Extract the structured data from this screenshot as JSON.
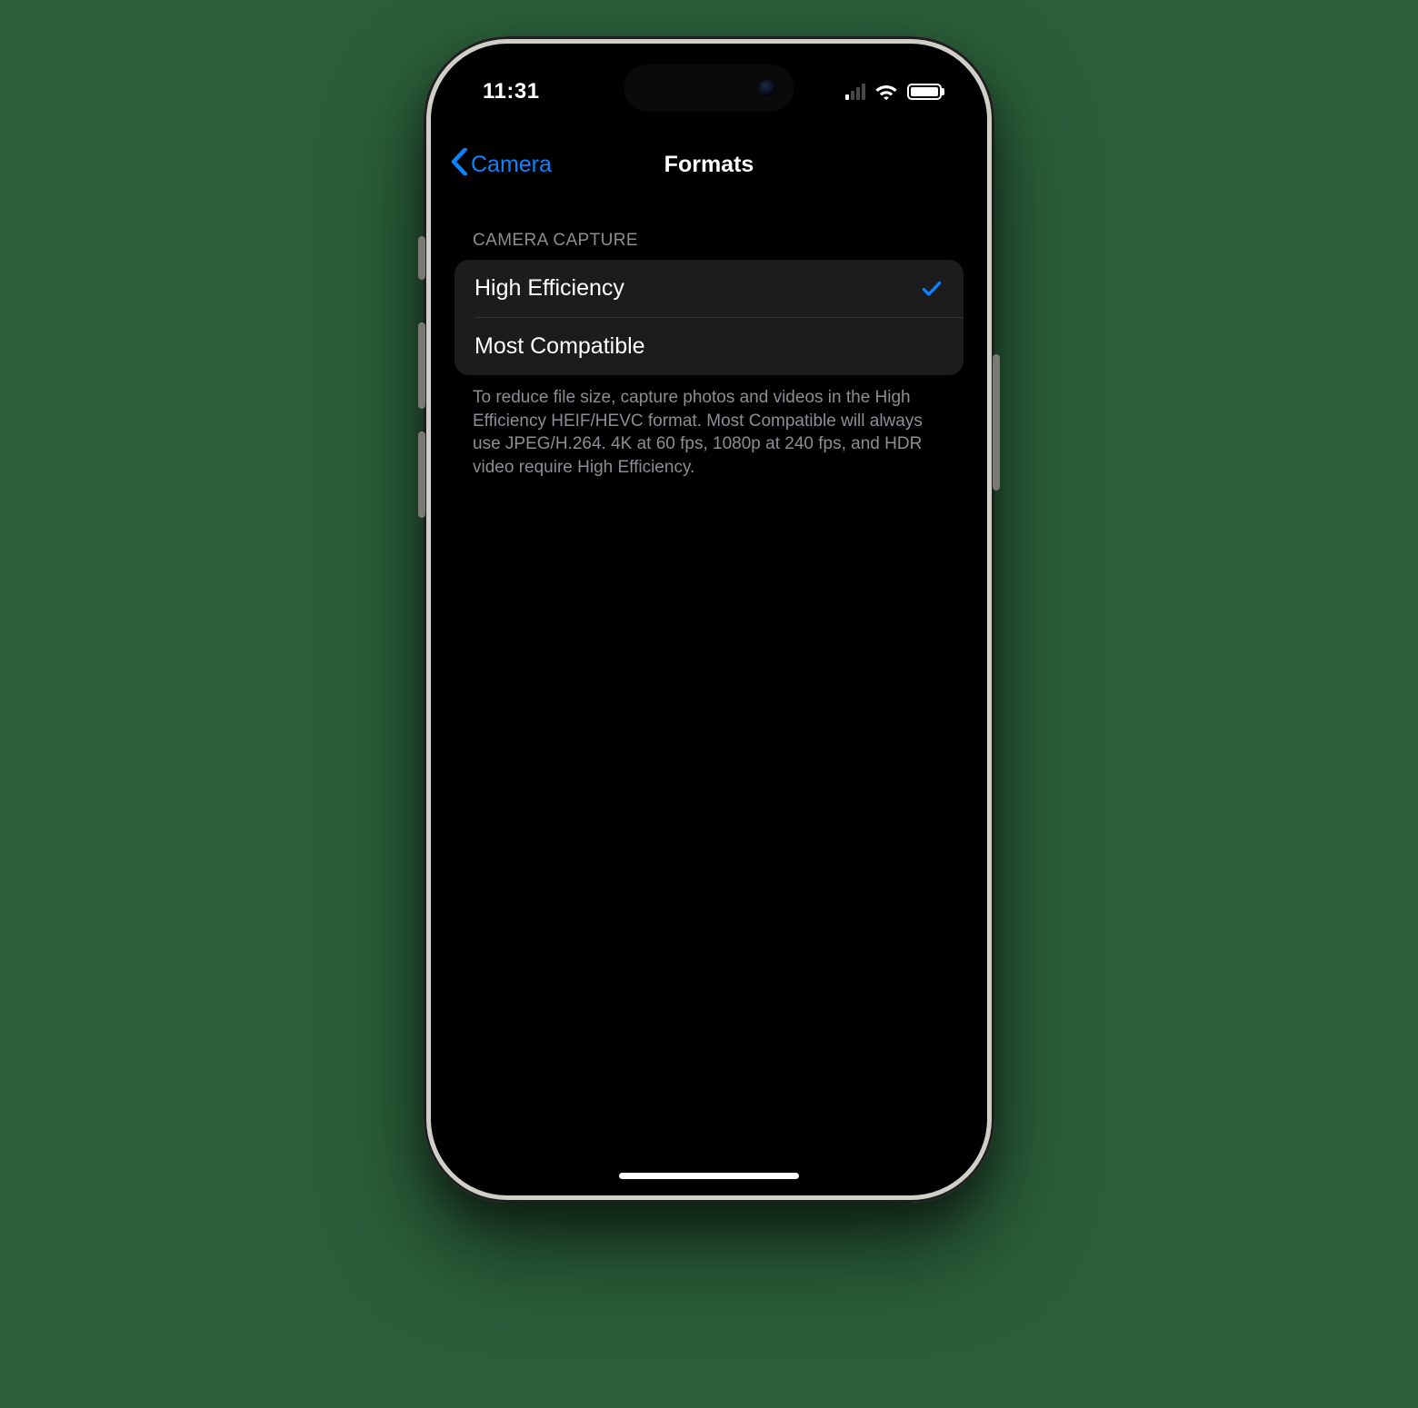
{
  "status": {
    "time": "11:31"
  },
  "nav": {
    "back_label": "Camera",
    "title": "Formats"
  },
  "section": {
    "header": "CAMERA CAPTURE",
    "options": [
      {
        "label": "High Efficiency",
        "selected": true
      },
      {
        "label": "Most Compatible",
        "selected": false
      }
    ],
    "footer": "To reduce file size, capture photos and videos in the High Efficiency HEIF/HEVC format. Most Compatible will always use JPEG/H.264. 4K at 60 fps, 1080p at 240 fps, and HDR video require High Efficiency."
  }
}
